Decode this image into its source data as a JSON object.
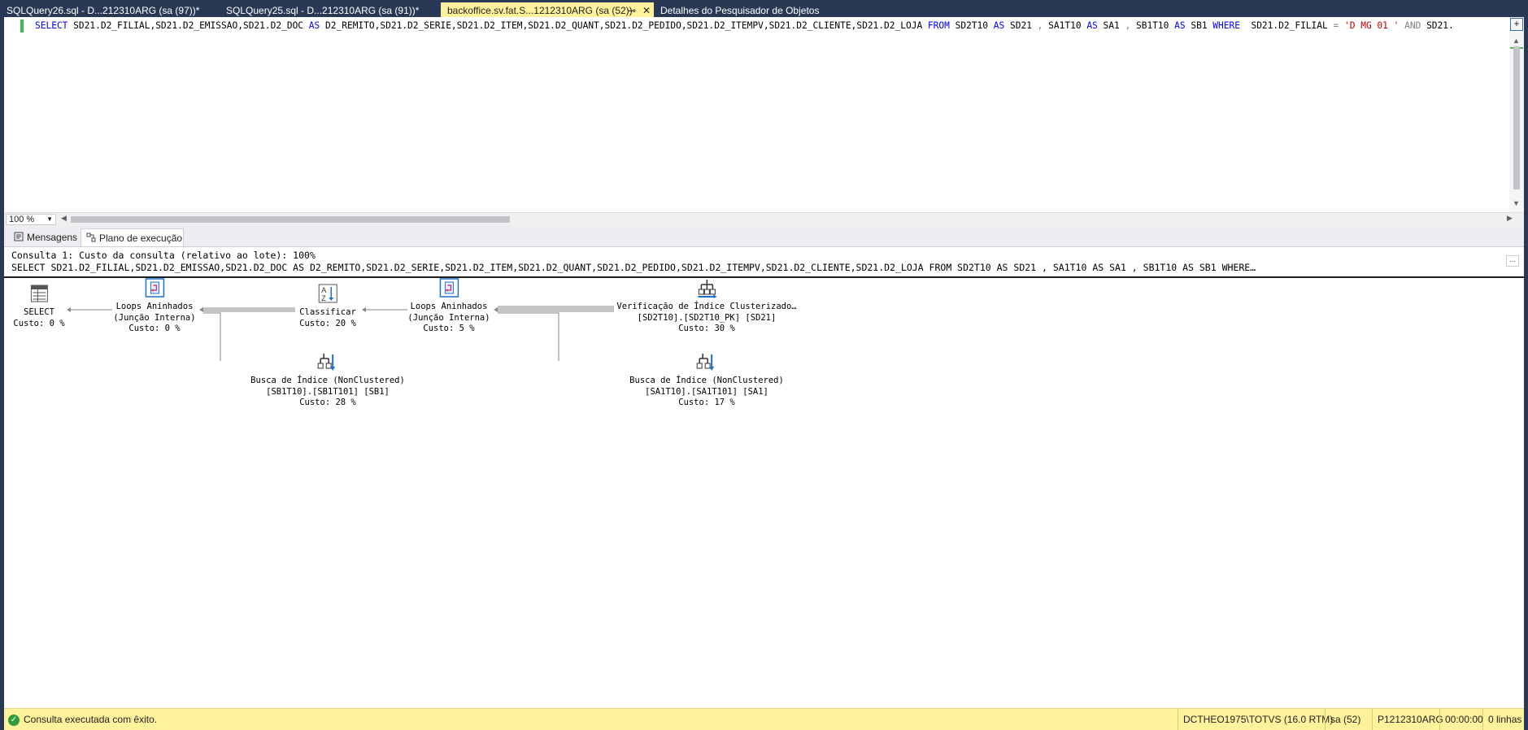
{
  "tabs": [
    {
      "label": "SQLQuery26.sql - D...212310ARG (sa (97))*",
      "active": false
    },
    {
      "label": "SQLQuery25.sql - D...212310ARG (sa (91))*",
      "active": false
    },
    {
      "label": "backoffice.sv.fat.S...1212310ARG (sa (52))",
      "active": true
    },
    {
      "label": "Detalhes do Pesquisador de Objetos",
      "active": false
    }
  ],
  "editor": {
    "line": [
      {
        "t": "SELECT",
        "c": "kw"
      },
      {
        "t": " SD21.D2_FILIAL,SD21.D2_EMISSAO,SD21.D2_DOC ",
        "c": ""
      },
      {
        "t": "AS",
        "c": "kw"
      },
      {
        "t": " D2_REMITO,SD21.D2_SERIE,SD21.D2_ITEM,SD21.D2_QUANT,SD21.D2_PEDIDO,SD21.D2_ITEMPV,SD21.D2_CLIENTE,SD21.D2_LOJA ",
        "c": ""
      },
      {
        "t": "FROM",
        "c": "kw"
      },
      {
        "t": " SD2T10 ",
        "c": ""
      },
      {
        "t": "AS",
        "c": "kw"
      },
      {
        "t": " SD21 ",
        "c": ""
      },
      {
        "t": ",",
        "c": "op"
      },
      {
        "t": " SA1T10 ",
        "c": ""
      },
      {
        "t": "AS",
        "c": "kw"
      },
      {
        "t": " SA1 ",
        "c": ""
      },
      {
        "t": ",",
        "c": "op"
      },
      {
        "t": " SB1T10 ",
        "c": ""
      },
      {
        "t": "AS",
        "c": "kw"
      },
      {
        "t": " SB1 ",
        "c": ""
      },
      {
        "t": "WHERE",
        "c": "kw"
      },
      {
        "t": "  SD21.D2_FILIAL ",
        "c": ""
      },
      {
        "t": "=",
        "c": "op"
      },
      {
        "t": " ",
        "c": ""
      },
      {
        "t": "'D MG 01 '",
        "c": "str"
      },
      {
        "t": " ",
        "c": ""
      },
      {
        "t": "AND",
        "c": "op"
      },
      {
        "t": " SD21.",
        "c": ""
      }
    ]
  },
  "zoom": "100 %",
  "result_tabs": {
    "messages": "Mensagens",
    "plan": "Plano de execução"
  },
  "plan": {
    "header": "Consulta 1: Custo da consulta (relativo ao lote): 100%",
    "sql": "SELECT SD21.D2_FILIAL,SD21.D2_EMISSAO,SD21.D2_DOC AS D2_REMITO,SD21.D2_SERIE,SD21.D2_ITEM,SD21.D2_QUANT,SD21.D2_PEDIDO,SD21.D2_ITEMPV,SD21.D2_CLIENTE,SD21.D2_LOJA FROM SD2T10 AS SD21 , SA1T10 AS SA1 , SB1T10 AS SB1 WHERE…",
    "nodes": {
      "select": {
        "title": "SELECT",
        "cost": "Custo: 0 %",
        "icon": "select-icon"
      },
      "loops1": {
        "title": "Loops Aninhados",
        "sub": "(Junção Interna)",
        "cost": "Custo: 0 %",
        "icon": "nested-loops-icon"
      },
      "sort": {
        "title": "Classificar",
        "cost": "Custo: 20 %",
        "icon": "sort-icon"
      },
      "loops2": {
        "title": "Loops Aninhados",
        "sub": "(Junção Interna)",
        "cost": "Custo: 5 %",
        "icon": "nested-loops-icon"
      },
      "scan": {
        "title": "Verificação de Índice Clusterizado…",
        "sub": "[SD2T10].[SD2T10_PK] [SD21]",
        "cost": "Custo: 30 %",
        "icon": "clustered-index-scan-icon"
      },
      "seek1": {
        "title": "Busca de Índice (NonClustered)",
        "sub": "[SB1T10].[SB1T101] [SB1]",
        "cost": "Custo: 28 %",
        "icon": "index-seek-icon"
      },
      "seek2": {
        "title": "Busca de Índice (NonClustered)",
        "sub": "[SA1T10].[SA1T101] [SA1]",
        "cost": "Custo: 17 %",
        "icon": "index-seek-icon"
      }
    }
  },
  "status": {
    "message": "Consulta executada com êxito.",
    "server": "DCTHEO1975\\TOTVS (16.0 RTM)",
    "user": "sa (52)",
    "database": "P1212310ARG",
    "time": "00:00:00",
    "rows": "0 linhas"
  },
  "colors": {
    "accent_tab": "#fff29d",
    "background": "#293955",
    "keyword": "#0000ff",
    "string": "#c00000"
  }
}
